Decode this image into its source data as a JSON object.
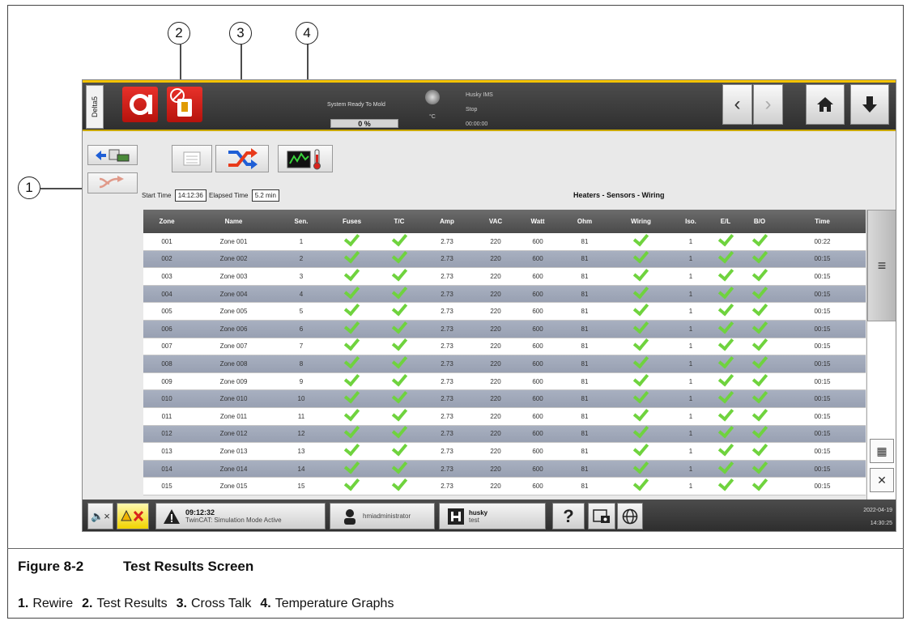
{
  "hmi": {
    "side_tab": "Delta5",
    "status_text": "System Ready To Mold",
    "progress_text": "0 %",
    "temp_unit": "°C",
    "ims_title": "Husky IMS",
    "ims_state": "Stop",
    "ims_time": "00:00:00",
    "start_time_label": "Start Time",
    "start_time_value": "14:12:36",
    "elapsed_label": "Elapsed Time",
    "elapsed_value": "5.2 min",
    "section_title": "Heaters - Sensors - Wiring"
  },
  "table": {
    "headers": [
      "Zone",
      "Name",
      "Sen.",
      "Fuses",
      "T/C",
      "Amp",
      "VAC",
      "Watt",
      "Ohm",
      "Wiring",
      "Iso.",
      "E/L",
      "B/O",
      "Time"
    ],
    "rows": [
      {
        "zone": "001",
        "name": "Zone 001",
        "sen": "1",
        "amp": "2.73",
        "vac": "220",
        "watt": "600",
        "ohm": "81",
        "iso": "1",
        "time": "00:22"
      },
      {
        "zone": "002",
        "name": "Zone 002",
        "sen": "2",
        "amp": "2.73",
        "vac": "220",
        "watt": "600",
        "ohm": "81",
        "iso": "1",
        "time": "00:15"
      },
      {
        "zone": "003",
        "name": "Zone 003",
        "sen": "3",
        "amp": "2.73",
        "vac": "220",
        "watt": "600",
        "ohm": "81",
        "iso": "1",
        "time": "00:15"
      },
      {
        "zone": "004",
        "name": "Zone 004",
        "sen": "4",
        "amp": "2.73",
        "vac": "220",
        "watt": "600",
        "ohm": "81",
        "iso": "1",
        "time": "00:15"
      },
      {
        "zone": "005",
        "name": "Zone 005",
        "sen": "5",
        "amp": "2.73",
        "vac": "220",
        "watt": "600",
        "ohm": "81",
        "iso": "1",
        "time": "00:15"
      },
      {
        "zone": "006",
        "name": "Zone 006",
        "sen": "6",
        "amp": "2.73",
        "vac": "220",
        "watt": "600",
        "ohm": "81",
        "iso": "1",
        "time": "00:15"
      },
      {
        "zone": "007",
        "name": "Zone 007",
        "sen": "7",
        "amp": "2.73",
        "vac": "220",
        "watt": "600",
        "ohm": "81",
        "iso": "1",
        "time": "00:15"
      },
      {
        "zone": "008",
        "name": "Zone 008",
        "sen": "8",
        "amp": "2.73",
        "vac": "220",
        "watt": "600",
        "ohm": "81",
        "iso": "1",
        "time": "00:15"
      },
      {
        "zone": "009",
        "name": "Zone 009",
        "sen": "9",
        "amp": "2.73",
        "vac": "220",
        "watt": "600",
        "ohm": "81",
        "iso": "1",
        "time": "00:15"
      },
      {
        "zone": "010",
        "name": "Zone 010",
        "sen": "10",
        "amp": "2.73",
        "vac": "220",
        "watt": "600",
        "ohm": "81",
        "iso": "1",
        "time": "00:15"
      },
      {
        "zone": "011",
        "name": "Zone 011",
        "sen": "11",
        "amp": "2.73",
        "vac": "220",
        "watt": "600",
        "ohm": "81",
        "iso": "1",
        "time": "00:15"
      },
      {
        "zone": "012",
        "name": "Zone 012",
        "sen": "12",
        "amp": "2.73",
        "vac": "220",
        "watt": "600",
        "ohm": "81",
        "iso": "1",
        "time": "00:15"
      },
      {
        "zone": "013",
        "name": "Zone 013",
        "sen": "13",
        "amp": "2.73",
        "vac": "220",
        "watt": "600",
        "ohm": "81",
        "iso": "1",
        "time": "00:15"
      },
      {
        "zone": "014",
        "name": "Zone 014",
        "sen": "14",
        "amp": "2.73",
        "vac": "220",
        "watt": "600",
        "ohm": "81",
        "iso": "1",
        "time": "00:15"
      },
      {
        "zone": "015",
        "name": "Zone 015",
        "sen": "15",
        "amp": "2.73",
        "vac": "220",
        "watt": "600",
        "ohm": "81",
        "iso": "1",
        "time": "00:15"
      }
    ]
  },
  "bottom": {
    "alarm_time": "09:12:32",
    "alarm_text": "TwinCAT: Simulation Mode Active",
    "user": "hmiadministrator",
    "husky_title": "husky",
    "husky_sub": "test",
    "help": "?",
    "date": "2022-04-19",
    "time": "14:30:25"
  },
  "callouts": [
    "1",
    "2",
    "3",
    "4"
  ],
  "caption": {
    "figure_number": "Figure 8-2",
    "figure_title": "Test Results Screen",
    "legend": [
      {
        "num": "1.",
        "label": "Rewire"
      },
      {
        "num": "2.",
        "label": "Test Results"
      },
      {
        "num": "3.",
        "label": "Cross Talk"
      },
      {
        "num": "4.",
        "label": "Temperature Graphs"
      }
    ]
  },
  "colors": {
    "accent_red": "#d8231c",
    "check_green": "#6fd33e",
    "header_gray": "#555555",
    "row_blue_gray": "#a0a8ba",
    "cross_talk_blue": "#1f5fd6",
    "cross_talk_red": "#e83a1a"
  },
  "icons": [
    "rewire-icon",
    "test-results-icon",
    "cross-talk-icon",
    "temperature-graph-icon",
    "back-arrow-icon",
    "home-icon",
    "download-icon",
    "mute-icon",
    "warning-icon",
    "user-icon",
    "help-icon",
    "screenshot-icon",
    "globe-icon"
  ]
}
